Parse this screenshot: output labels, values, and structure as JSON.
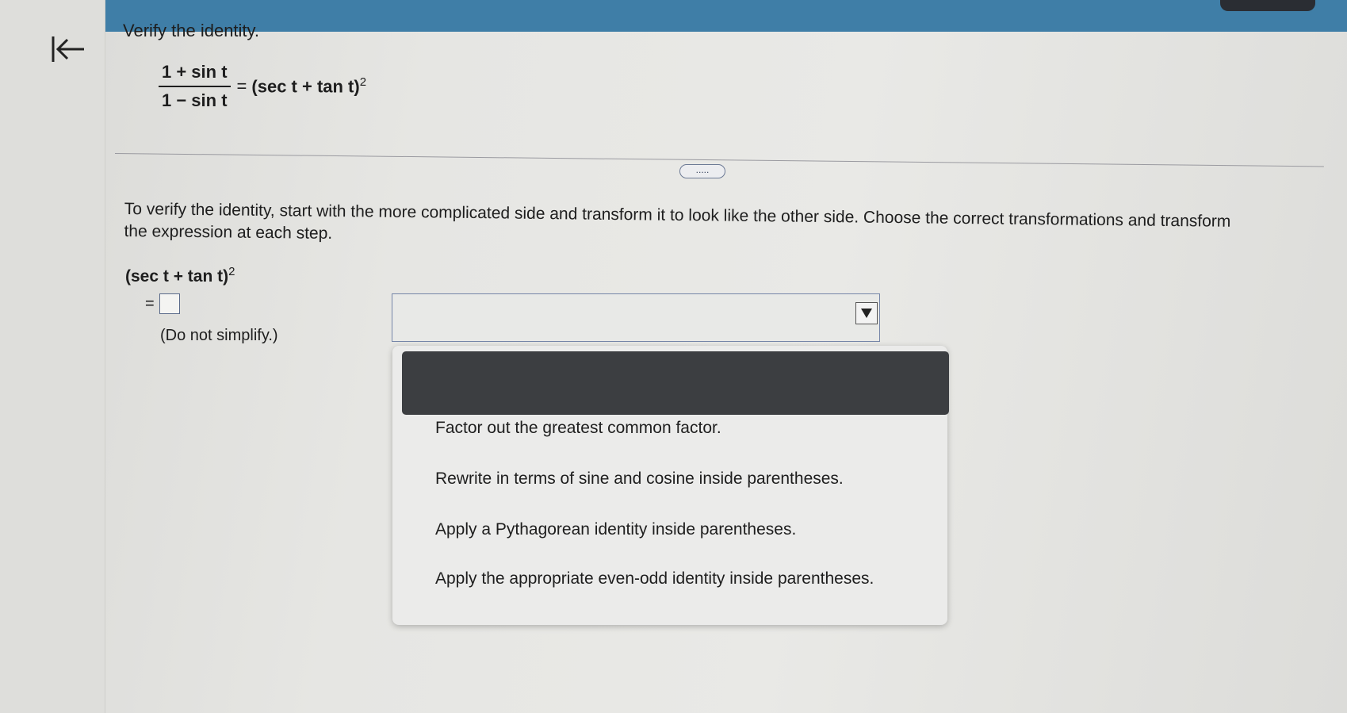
{
  "page": {
    "title": "Verify the identity.",
    "more_label": "....."
  },
  "identity": {
    "numerator": "1 + sin t",
    "denominator": "1 − sin t",
    "equals": "=",
    "rhs": "(sec t + tan t)",
    "rhs_exponent": "2"
  },
  "instructions": "To verify the identity, start with the more complicated side and transform it to look like the other side. Choose the correct transformations and transform the expression at each step.",
  "work": {
    "expression": "(sec t + tan t)",
    "expression_exponent": "2",
    "equals": "=",
    "answer_value": "",
    "hint": "(Do not simplify.)"
  },
  "dropdown": {
    "selected": "",
    "options": [
      "Factor out the greatest common factor.",
      "Rewrite in terms of sine and cosine inside parentheses.",
      "Apply a Pythagorean identity inside parentheses.",
      "Apply the appropriate even-odd identity inside parentheses."
    ]
  },
  "colors": {
    "topbar": "#3f7ea7",
    "menu_header": "#3c3e41",
    "border_accent": "#7585a8"
  },
  "icons": {
    "back": "back-to-start-icon",
    "dropdown": "dropdown-arrow-icon"
  }
}
